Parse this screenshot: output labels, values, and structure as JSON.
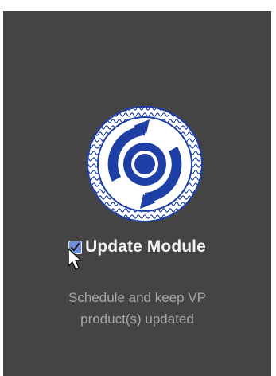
{
  "module": {
    "title": "Update Module",
    "checked": true,
    "description_line1": "Schedule and keep VP",
    "description_line2": "product(s) updated"
  },
  "icons": {
    "logo": "update-module-logo",
    "checkbox": "checkbox-checked-icon",
    "cursor": "mouse-pointer"
  },
  "colors": {
    "card_background": "#444444",
    "logo_blue": "#1e3fa6",
    "title_text": "#f2f2f2",
    "description_text": "#a7a7a7"
  }
}
